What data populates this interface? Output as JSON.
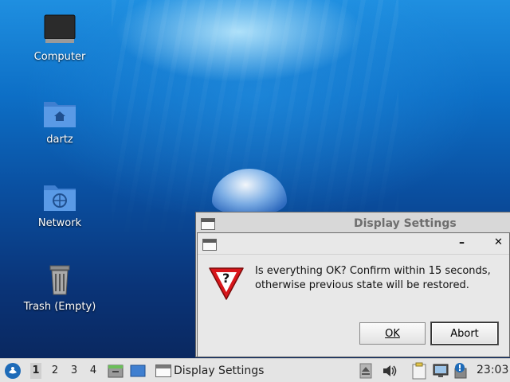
{
  "desktop": {
    "icons": [
      {
        "label": "Computer",
        "icon": "computer-icon"
      },
      {
        "label": "dartz",
        "icon": "home-folder-icon"
      },
      {
        "label": "Network",
        "icon": "network-folder-icon"
      },
      {
        "label": "Trash (Empty)",
        "icon": "trash-icon"
      }
    ]
  },
  "parent_window": {
    "title": "Display Settings"
  },
  "dialog": {
    "message_line1": "Is everything OK? Confirm within 15 seconds,",
    "message_line2": "otherwise previous state will be restored.",
    "ok_label": "OK",
    "abort_label": "Abort",
    "minimize_glyph": "–",
    "close_glyph": "✕",
    "icon_glyph": "?"
  },
  "taskbar": {
    "workspaces": [
      "1",
      "2",
      "3",
      "4"
    ],
    "active_workspace": "1",
    "task_label": "Display Settings",
    "clock": "23:03"
  },
  "colors": {
    "taskbar_bg": "#e4e4e4",
    "dialog_bg": "#e8e8e8",
    "warning_red": "#d8161b"
  }
}
